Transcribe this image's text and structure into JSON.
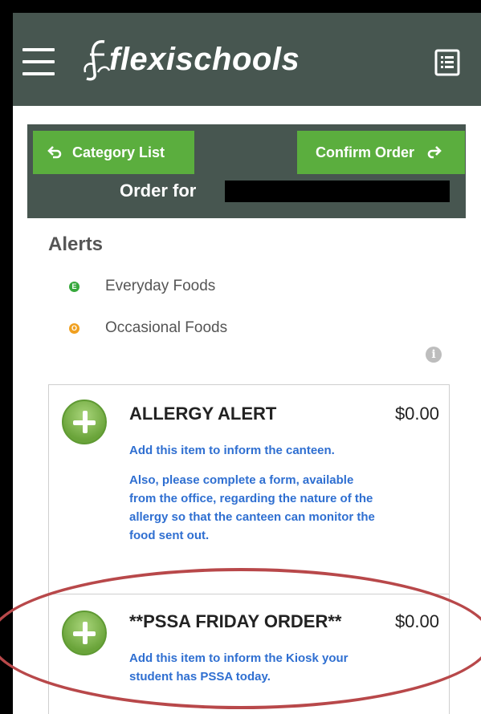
{
  "app": {
    "logo_text": "flexischools"
  },
  "nav": {
    "category_list_label": "Category List",
    "confirm_order_label": "Confirm Order",
    "order_for_label": "Order for"
  },
  "alerts": {
    "title": "Alerts",
    "legend": [
      {
        "badge": "E",
        "label": "Everyday Foods",
        "color": "#37a83c"
      },
      {
        "badge": "O",
        "label": "Occasional Foods",
        "color": "#f0a020"
      }
    ]
  },
  "items": [
    {
      "name": "ALLERGY ALERT",
      "price": "$0.00",
      "desc1": "Add this item to inform the canteen.",
      "desc2": "Also, please complete a form, available from the office, regarding the nature of the allergy so that the canteen can monitor the food sent out."
    },
    {
      "name": "**PSSA FRIDAY ORDER**",
      "price": "$0.00",
      "desc1": "Add this item to inform the Kiosk your student has PSSA today."
    }
  ],
  "colors": {
    "header": "#475650",
    "button": "#5bae3e",
    "link": "#2f6fd1",
    "highlight": "#b8484a"
  }
}
